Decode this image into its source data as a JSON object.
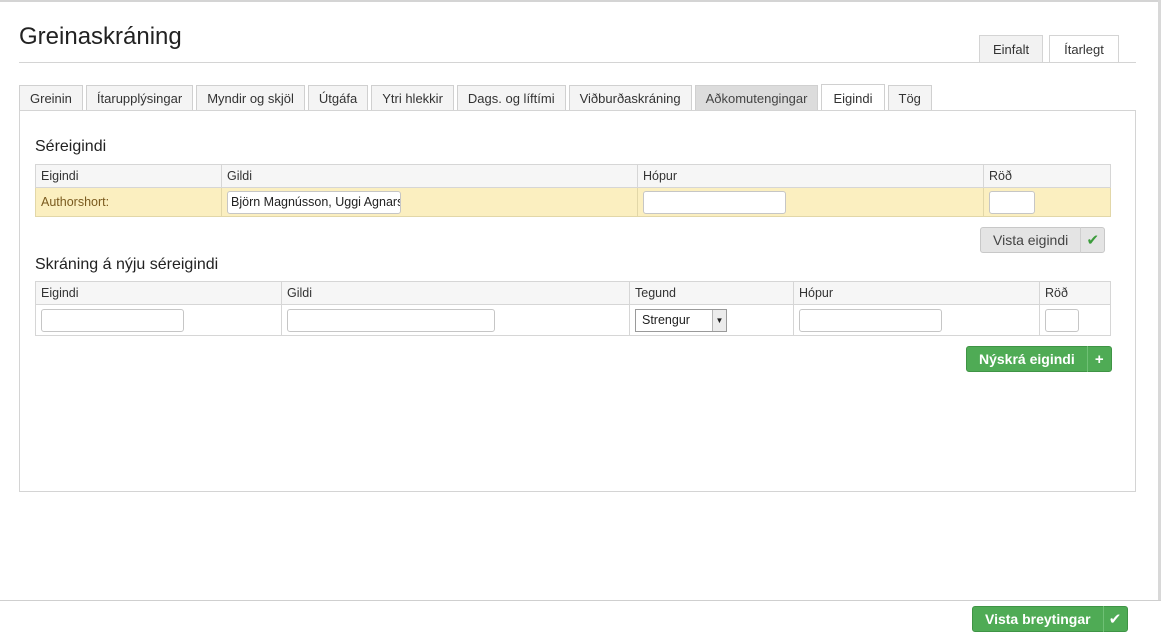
{
  "header": {
    "title": "Greinaskráning"
  },
  "mode_tabs": [
    {
      "label": "Einfalt",
      "active": false
    },
    {
      "label": "Ítarlegt",
      "active": true
    }
  ],
  "tabs": [
    {
      "label": "Greinin"
    },
    {
      "label": "Ítarupplýsingar"
    },
    {
      "label": "Myndir og skjöl"
    },
    {
      "label": "Útgáfa"
    },
    {
      "label": "Ytri hlekkir"
    },
    {
      "label": "Dags. og líftími"
    },
    {
      "label": "Viðburðaskráning"
    },
    {
      "label": "Aðkomutengingar"
    },
    {
      "label": "Eigindi"
    },
    {
      "label": "Tög"
    }
  ],
  "custom_props": {
    "title": "Séreigindi",
    "columns": {
      "property": "Eigindi",
      "value": "Gildi",
      "group": "Hópur",
      "order": "Röð"
    },
    "rows": [
      {
        "property": "Authorshort:",
        "value": "Björn Magnússon, Uggi Agnarsson",
        "group": "",
        "order": ""
      }
    ],
    "save_label": "Vista eigindi"
  },
  "new_prop": {
    "title": "Skráning á nýju séreigindi",
    "columns": {
      "property": "Eigindi",
      "value": "Gildi",
      "type": "Tegund",
      "group": "Hópur",
      "order": "Röð"
    },
    "property": "",
    "value": "",
    "type": "Strengur",
    "group": "",
    "order": "",
    "add_label": "Nýskrá eigindi"
  },
  "footer": {
    "save_label": "Vista breytingar"
  },
  "colors": {
    "accent_green": "#4fab55",
    "highlight_row": "#fbefc0"
  }
}
